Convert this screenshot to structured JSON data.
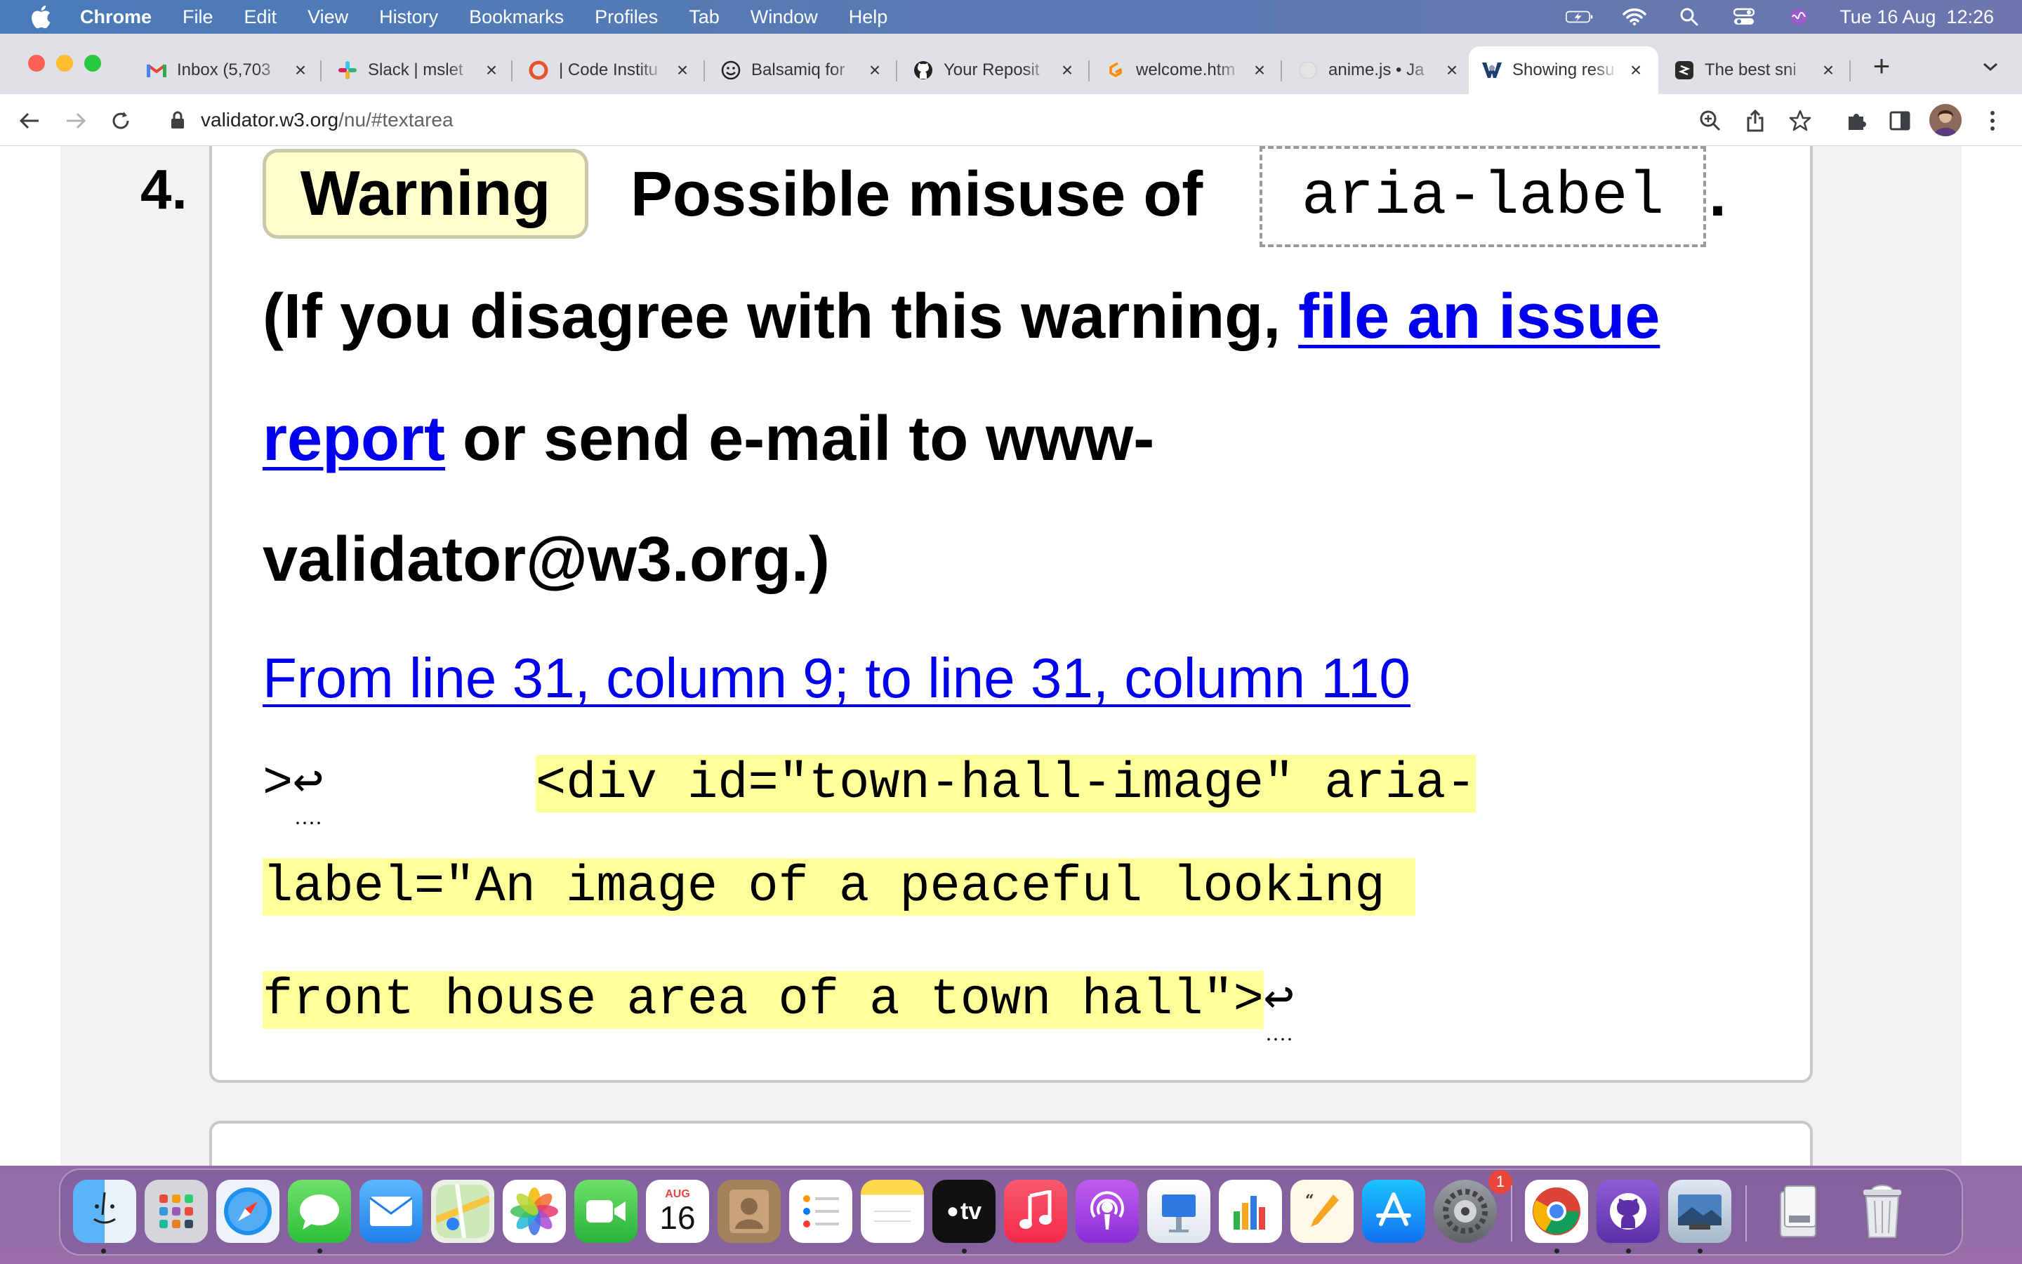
{
  "menubar": {
    "app_name": "Chrome",
    "items": [
      "File",
      "Edit",
      "View",
      "History",
      "Bookmarks",
      "Profiles",
      "Tab",
      "Window",
      "Help"
    ],
    "datetime": "Tue 16 Aug  12:26"
  },
  "tabs": [
    {
      "title": "Inbox (5,703",
      "icon": "gmail-icon",
      "active": false
    },
    {
      "title": "Slack | mslet",
      "icon": "slack-icon",
      "active": false
    },
    {
      "title": "| Code Institu",
      "icon": "code-institute-icon",
      "active": false
    },
    {
      "title": "Balsamiq for",
      "icon": "balsamiq-icon",
      "active": false
    },
    {
      "title": "Your Reposit",
      "icon": "github-icon",
      "active": false
    },
    {
      "title": "welcome.htm",
      "icon": "gitpod-icon",
      "active": false
    },
    {
      "title": "anime.js • Ja",
      "icon": "anime-icon",
      "active": false
    },
    {
      "title": "Showing resu",
      "icon": "w3c-validator-icon",
      "active": true
    },
    {
      "title": "The best sni",
      "icon": "snippet-icon",
      "active": false
    }
  ],
  "omnibox": {
    "host": "validator.w3.org",
    "path": "/nu/#textarea"
  },
  "message": {
    "number": "4.",
    "badge": "Warning",
    "summary": "Possible misuse of",
    "attribute": "aria-label",
    "period": ".",
    "disagree_prefix": "(If you disagree with this warning,",
    "issue_link_part1": "file an issue",
    "issue_link_part2": "report",
    "email_text_1": "or send e-mail to www-",
    "email_text_2": "validator@w3.org.)",
    "location": "From line 31, column 9; to line 31, column 110",
    "code_prefix": ">",
    "code_line1": "<div id=\"town-hall-image\" aria-",
    "code_line2": "label=\"An image of a peaceful looking ",
    "code_line3": "front house area of a town hall\">"
  },
  "dock": {
    "calendar_month": "AUG",
    "calendar_day": "16",
    "appletv_label": "tv",
    "settings_badge": "1"
  },
  "colors": {
    "link": "#0000ee",
    "warning_bg": "#ffffcc",
    "code_highlight": "#ffff99"
  }
}
